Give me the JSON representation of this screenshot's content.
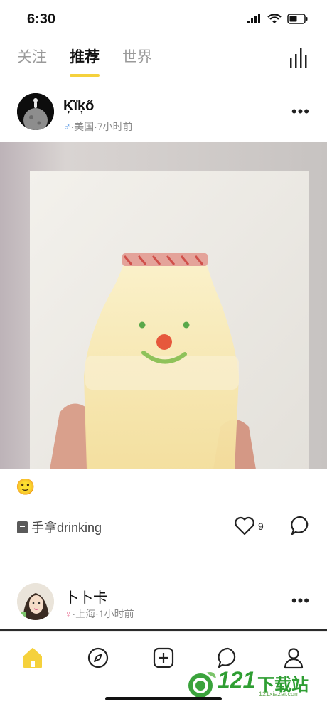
{
  "status_bar": {
    "time": "6:30"
  },
  "top_tabs": [
    {
      "label": "关注"
    },
    {
      "label": "推荐"
    },
    {
      "label": "世界"
    }
  ],
  "posts": [
    {
      "username": "Ķïķő",
      "gender_symbol": "♂",
      "meta": "·美国·7小时前",
      "caption_emoji": "🙂",
      "tag_label": "手拿drinking",
      "like_count": "9"
    },
    {
      "username": "卜卜卡",
      "gender_symbol": "♀",
      "meta": "·上海·1小时前"
    }
  ],
  "watermark": {
    "number": "121",
    "text": "下载站",
    "url": "121xiazai.com"
  },
  "colors": {
    "accent": "#f5d13c",
    "male": "#4a90e2",
    "female": "#e86a8f"
  }
}
